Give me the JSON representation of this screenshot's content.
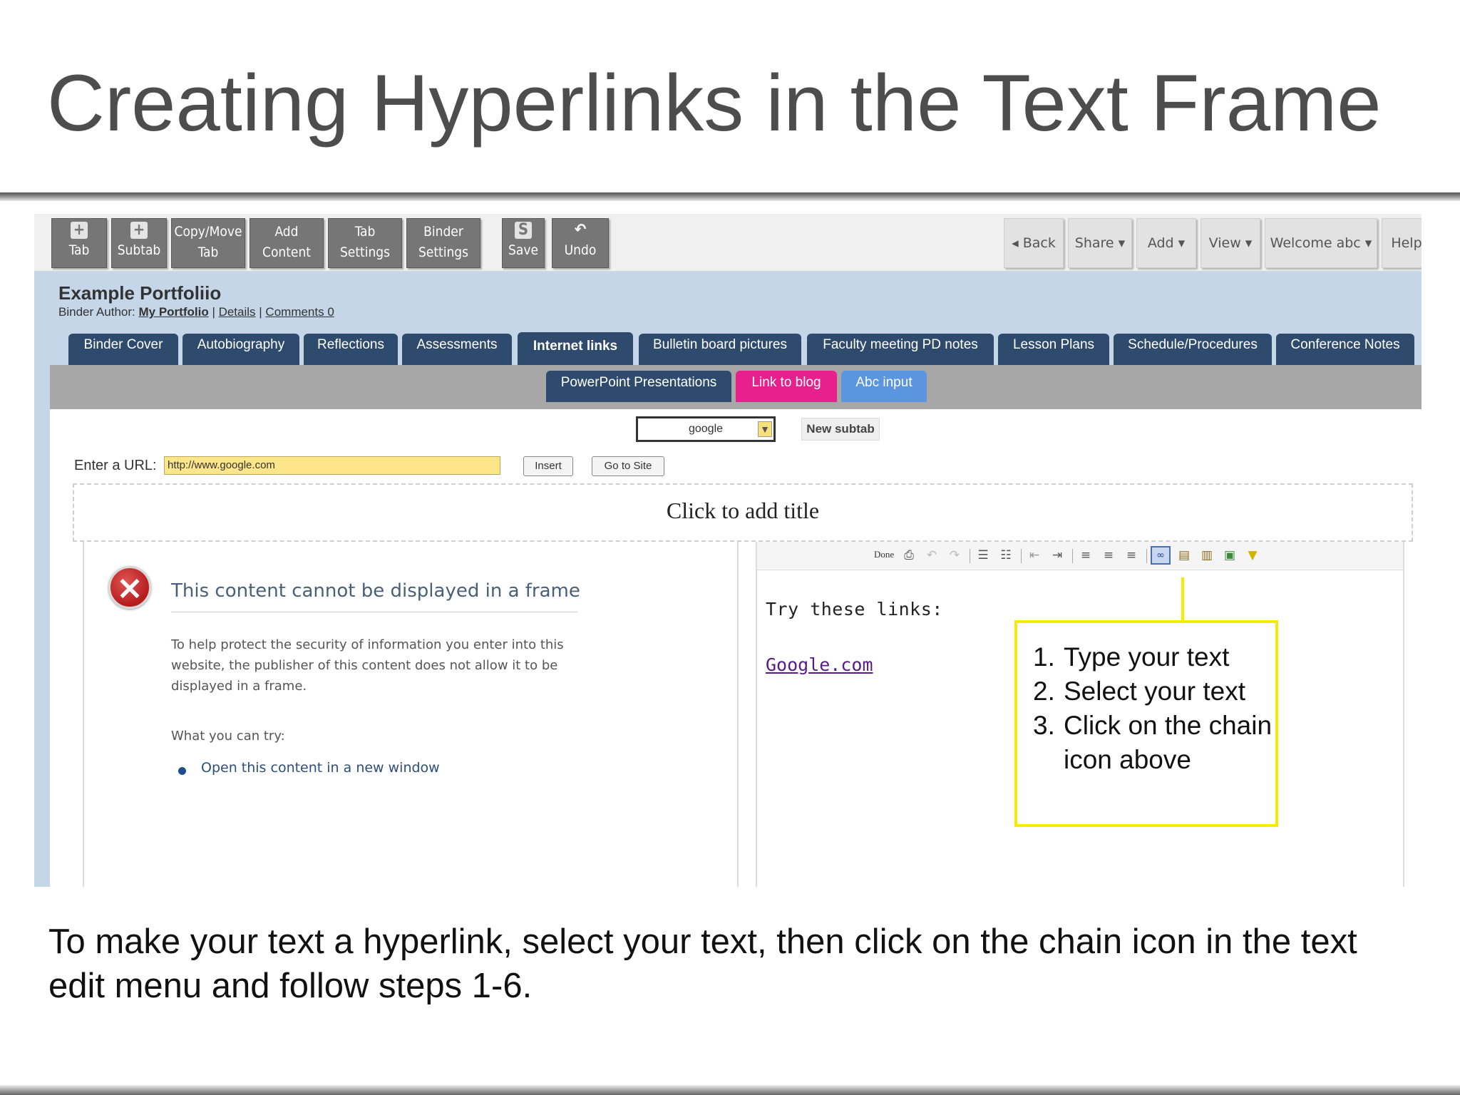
{
  "slide": {
    "title": "Creating Hyperlinks in the Text Frame",
    "caption": "To make your text a hyperlink, select your text, then click on the chain icon in the text edit menu and follow steps 1-6."
  },
  "toolbar": {
    "buttons": [
      {
        "line1": "",
        "line2": "Tab",
        "icon": "plus-icon"
      },
      {
        "line1": "",
        "line2": "Subtab",
        "icon": "plus-icon"
      },
      {
        "line1": "Copy/Move",
        "line2": "Tab",
        "icon": ""
      },
      {
        "line1": "Add",
        "line2": "Content",
        "icon": ""
      },
      {
        "line1": "Tab",
        "line2": "Settings",
        "icon": ""
      },
      {
        "line1": "Binder",
        "line2": "Settings",
        "icon": ""
      },
      {
        "line1": "",
        "line2": "Save",
        "icon": "save-icon"
      },
      {
        "line1": "",
        "line2": "Undo",
        "icon": "undo-icon"
      }
    ],
    "nav": [
      "◂ Back",
      "Share ▾",
      "Add ▾",
      "View ▾",
      "Welcome abc ▾",
      "Help"
    ]
  },
  "portfolio": {
    "title": "Example Portfoliio",
    "author_label": "Binder Author:",
    "author_name": "My Portfolio",
    "details": "Details",
    "comments": "Comments 0"
  },
  "tabs": [
    "Binder Cover",
    "Autobiography",
    "Reflections",
    "Assessments",
    "Internet links",
    "Bulletin board pictures",
    "Faculty meeting PD notes",
    "Lesson Plans",
    "Schedule/Procedures",
    "Conference Notes"
  ],
  "active_tab": "Internet links",
  "subtabs": [
    {
      "label": "PowerPoint Presentations",
      "color": "#2e4b6e"
    },
    {
      "label": "Link to blog",
      "color": "#e8208e"
    },
    {
      "label": "Abc input",
      "color": "#5b95e0"
    }
  ],
  "content": {
    "dropdown_value": "google",
    "new_subtab": "New subtab",
    "url_label": "Enter a URL:",
    "url_value": "http://www.google.com",
    "insert_button": "Insert",
    "go_button": "Go to Site",
    "title_placeholder": "Click to add title"
  },
  "error_frame": {
    "title": "This content cannot be displayed in a frame",
    "body": "To help protect the security of information you enter into this website, the publisher of this content does not allow it to be displayed in a frame.",
    "try_label": "What you can try:",
    "link": "Open this content in a new window"
  },
  "editor": {
    "done": "Done",
    "heading": "Try these links:",
    "link_text": "Google.com"
  },
  "callout": {
    "steps": [
      "Type your text",
      "Select your text",
      "Click on the chain icon above"
    ]
  },
  "colors": {
    "accent_tab": "#2e4b6e",
    "callout_border": "#f5ec00",
    "url_field": "#fde68a"
  }
}
